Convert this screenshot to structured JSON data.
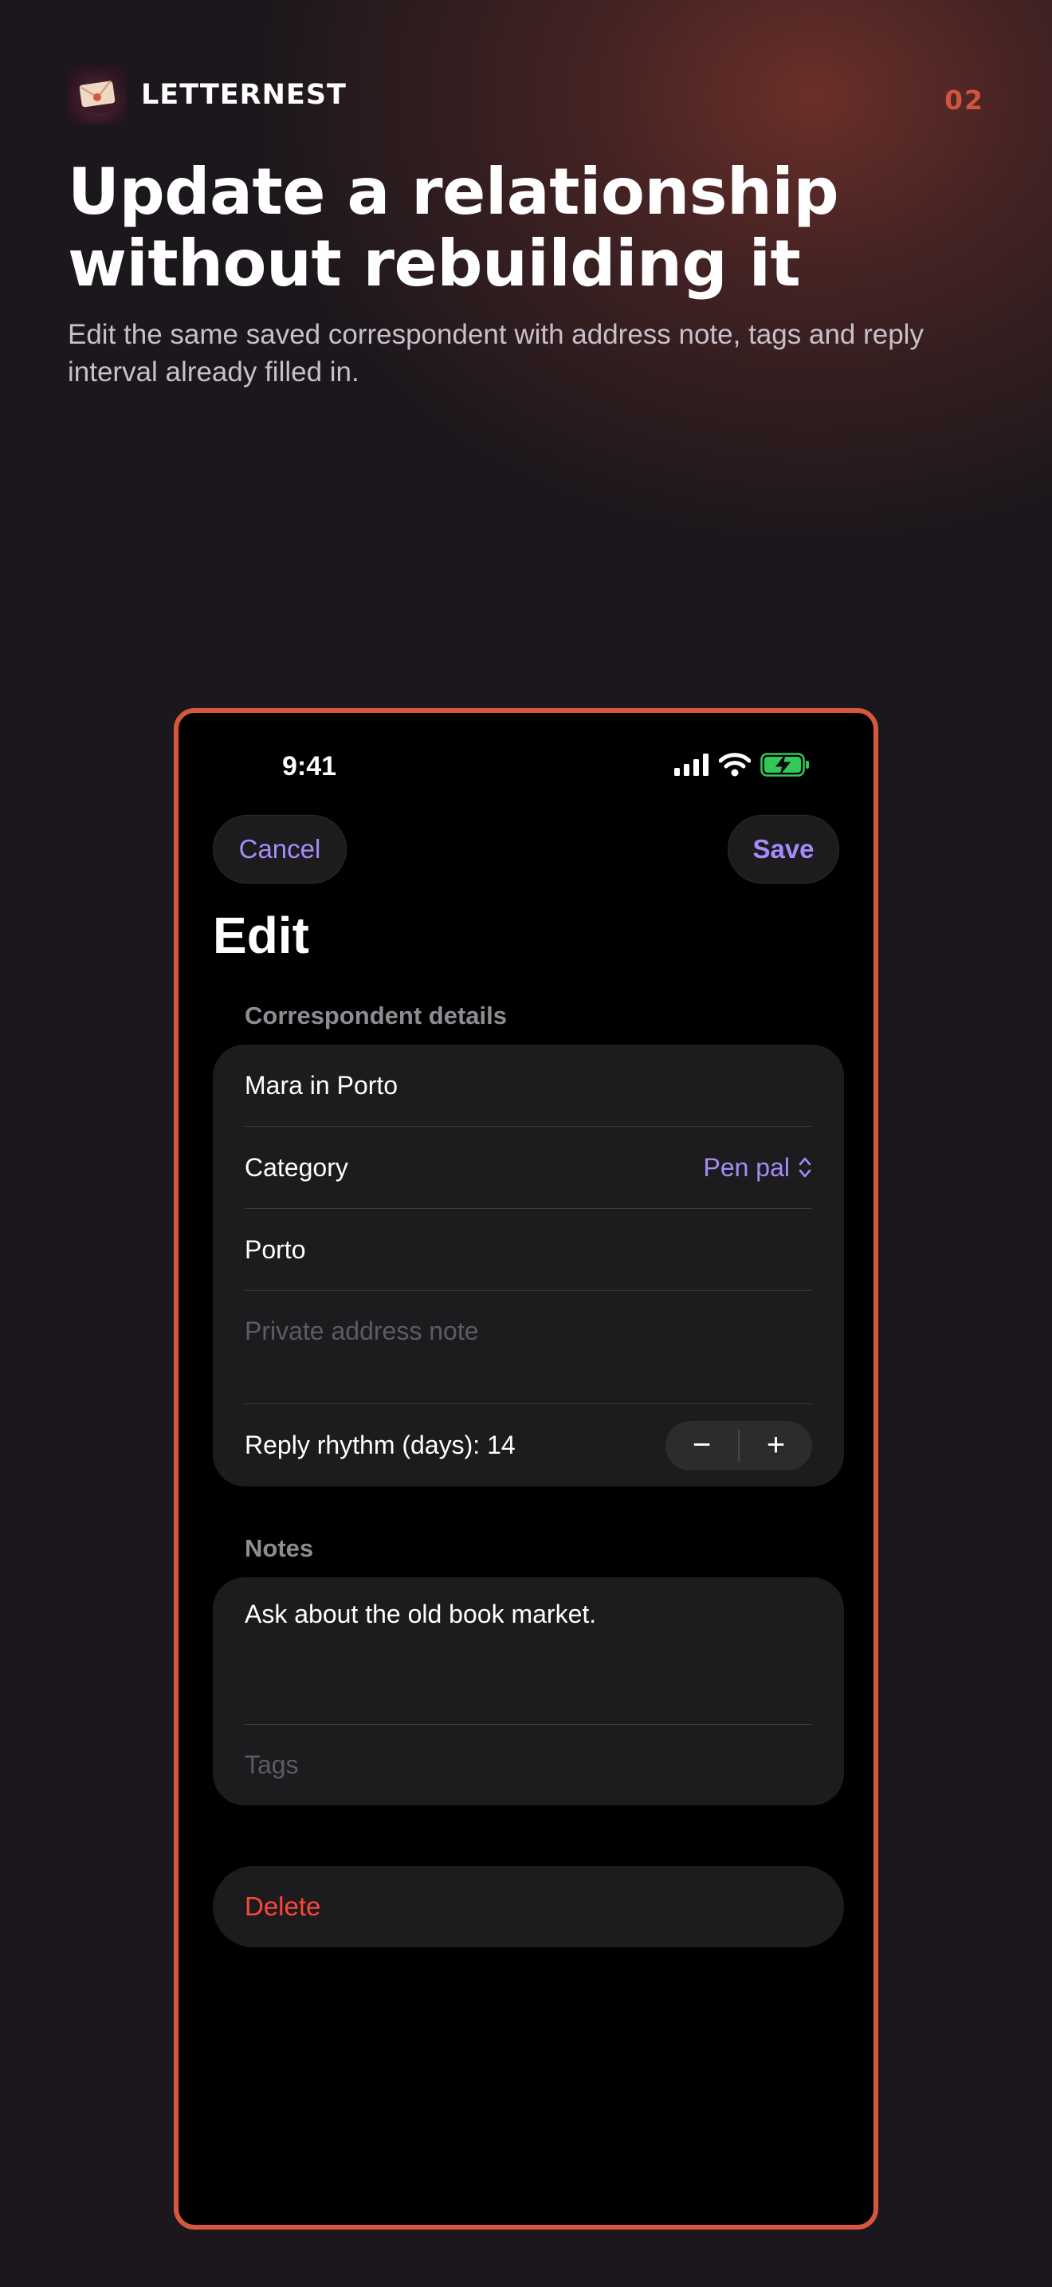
{
  "brand": {
    "name": "LETTERNEST",
    "icon": "envelope-app-icon"
  },
  "page_number": "02",
  "headline": "Update a relationship without rebuilding it",
  "subhead": "Edit the same saved correspondent with address note, tags and reply interval already filled in.",
  "phone": {
    "status_bar": {
      "time": "9:41",
      "icons": [
        "cellular-signal-icon",
        "wifi-icon",
        "battery-charging-icon"
      ]
    },
    "nav": {
      "cancel_label": "Cancel",
      "save_label": "Save"
    },
    "title": "Edit",
    "correspondent_section": {
      "label": "Correspondent details",
      "name_value": "Mara in Porto",
      "category_label": "Category",
      "category_value": "Pen pal",
      "city_value": "Porto",
      "address_note_placeholder": "Private address note",
      "reply_rhythm_label": "Reply rhythm (days): 14",
      "stepper_minus": "−",
      "stepper_plus": "+"
    },
    "notes_section": {
      "label": "Notes",
      "notes_value": "Ask about the old book market.",
      "tags_placeholder": "Tags"
    },
    "delete_label": "Delete"
  },
  "colors": {
    "accent": "#a78bfa",
    "brand_orange": "#d5583e",
    "destructive": "#ff453a",
    "battery": "#34c759"
  }
}
